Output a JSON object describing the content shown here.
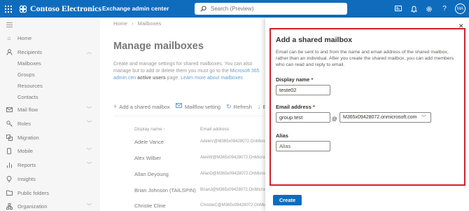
{
  "topbar": {
    "brand": "Contoso Electronics",
    "app_name": "Exchange admin center",
    "search_placeholder": "Search (Preview)",
    "avatar_initials": "MA",
    "accent": "#0f6cbd"
  },
  "sidebar": {
    "items": [
      {
        "label": "Home",
        "icon": "home-icon"
      },
      {
        "label": "Recipients",
        "icon": "person-icon",
        "expanded": true
      },
      {
        "label": "Mail flow",
        "icon": "mail-icon"
      },
      {
        "label": "Roles",
        "icon": "key-icon"
      },
      {
        "label": "Migration",
        "icon": "migration-icon"
      },
      {
        "label": "Mobile",
        "icon": "mobile-icon"
      },
      {
        "label": "Reports",
        "icon": "chart-icon"
      },
      {
        "label": "Insights",
        "icon": "lightbulb-icon"
      },
      {
        "label": "Public folders",
        "icon": "folder-icon"
      },
      {
        "label": "Organization",
        "icon": "organization-icon"
      }
    ],
    "subitems": [
      "Mailboxes",
      "Groups",
      "Resources",
      "Contacts"
    ]
  },
  "main": {
    "breadcrumb": [
      "Home",
      "Mailboxes"
    ],
    "title": "Manage mailboxes",
    "desc_1": "Create and manage settings for shared mailboxes. You can also manage",
    "desc_2": "but to add or delete them you must go to the ",
    "desc_link": "Microsoft 365 admin cen",
    "desc_3": "active users",
    "desc_4": " page. ",
    "desc_link2": "Learn more about mailboxes",
    "commands": {
      "add": "Add a shared mailbox",
      "mailflow": "Mailflow setting",
      "refresh": "Refresh",
      "export": "Ex"
    },
    "columns": {
      "display_name": "Display name",
      "sort_arrow": "↑",
      "email": "Email address"
    },
    "rows": [
      {
        "name": "Adele Vance",
        "email": "AdeleV@M365x09428072.OnMicros"
      },
      {
        "name": "Alex Wilber",
        "email": "AlexW@M365x09428072.OnMicros"
      },
      {
        "name": "Allan Deyoung",
        "email": "AllanD@M365x09428072.OnMicros"
      },
      {
        "name": "Brian Johnson (TAILSPIN)",
        "email": "BrianJ@M365x09428072.OnMicros"
      },
      {
        "name": "Christie Cline",
        "email": "ChristieC@M365x09428072.OnMicr"
      }
    ]
  },
  "panel": {
    "title": "Add a shared mailbox",
    "description": "Email can be sent to and from the name and email address of the shared mailbox, rather than an individual. After you create the shared mailbox, you can add members who can read and reply to email.",
    "display_name_label": "Display name",
    "display_name_value": "teste02",
    "email_label": "Email address",
    "email_value": "group.test",
    "at": "@",
    "domain_value": "M365x09428072.onmicrosoft.com",
    "alias_label": "Alias",
    "alias_placeholder": "Alias",
    "required_mark": "*",
    "create_label": "Create",
    "highlight_color": "#d21f2e"
  }
}
